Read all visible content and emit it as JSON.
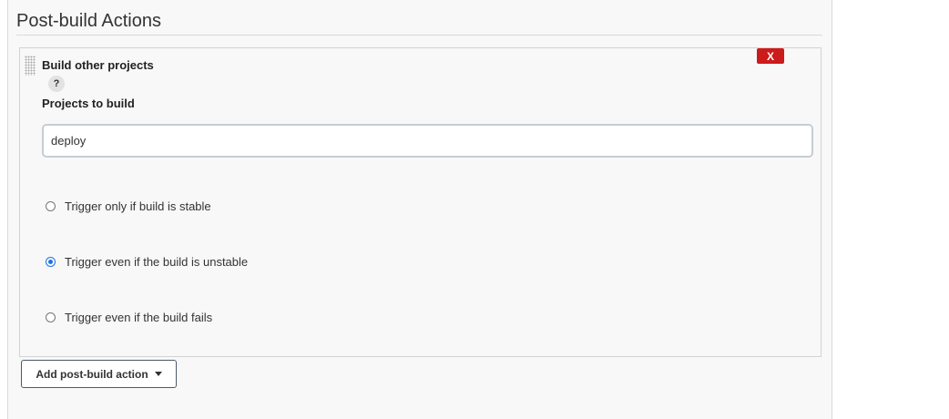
{
  "section": {
    "title": "Post-build Actions"
  },
  "step": {
    "title": "Build other projects",
    "delete_label": "X",
    "help_label": "?",
    "projects_label": "Projects to build",
    "projects_value": "deploy",
    "trigger_options": [
      {
        "label": "Trigger only if build is stable",
        "checked": false
      },
      {
        "label": "Trigger even if the build is unstable",
        "checked": true
      },
      {
        "label": "Trigger even if the build fails",
        "checked": false
      }
    ]
  },
  "add_button": {
    "label": "Add post-build action",
    "icon": "caret-down-icon"
  },
  "colors": {
    "delete_red": "#cc1b1b",
    "radio_blue": "#1a73e8"
  }
}
